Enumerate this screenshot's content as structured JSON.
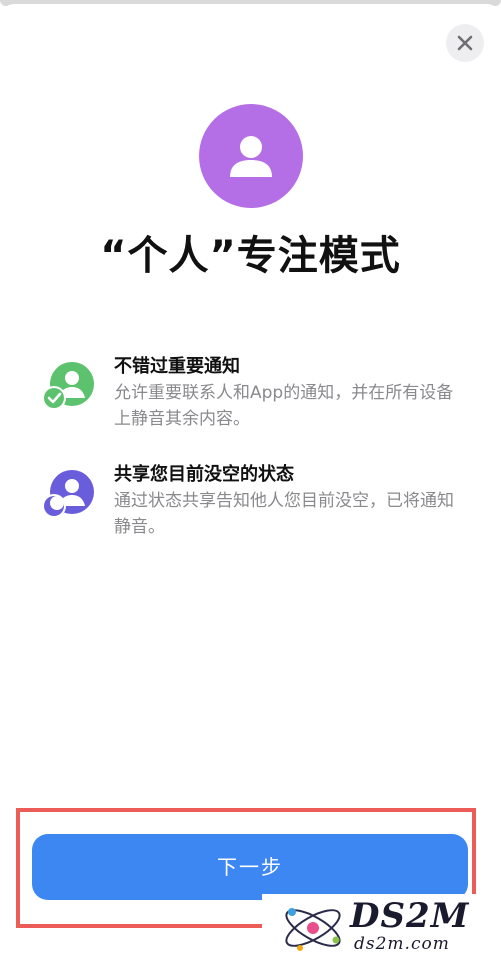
{
  "header": {
    "title": "“个人”专注模式"
  },
  "features": [
    {
      "title": "不错过重要通知",
      "desc": "允许重要联系人和App的通知，并在所有设备上静音其余内容。",
      "icon": "person-check-icon",
      "color": "#5cc26d"
    },
    {
      "title": "共享您目前没空的状态",
      "desc": "通过状态共享告知他人您目前没空，已将通知静音。",
      "icon": "person-moon-icon",
      "color": "#6a5ddc"
    }
  ],
  "footer": {
    "next_label": "下一步"
  },
  "watermark": {
    "brand": "DS2M",
    "site": "ds2m.com"
  },
  "colors": {
    "accent": "#3d87f2",
    "focus_purple": "#b56fe6",
    "highlight_red": "#ec5d57"
  }
}
